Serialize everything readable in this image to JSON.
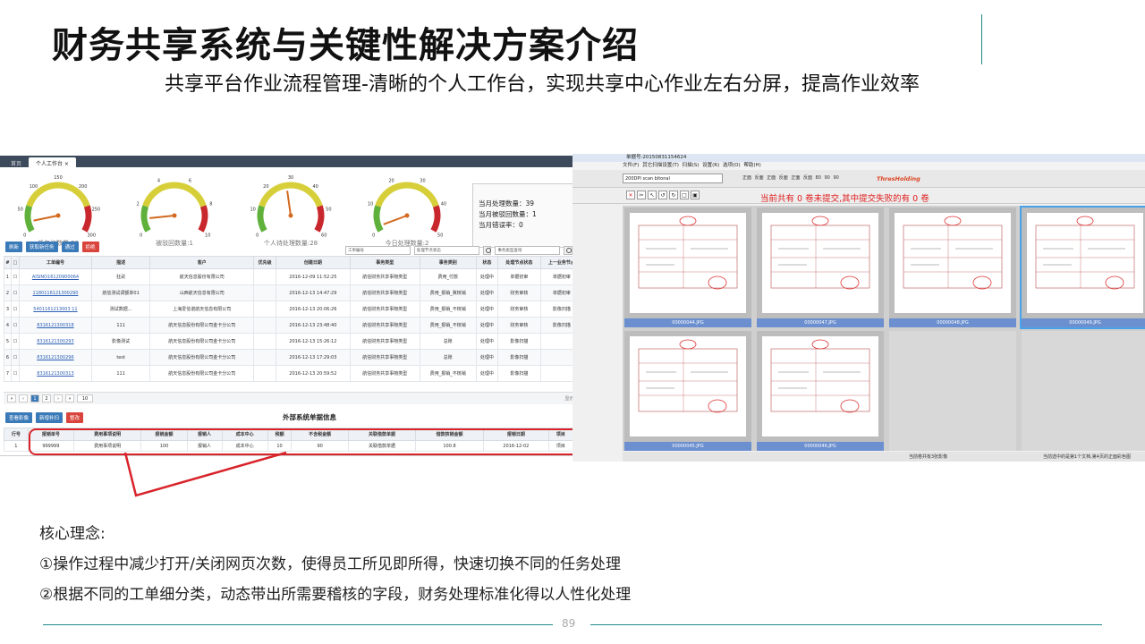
{
  "slide": {
    "title": "财务共享系统与关键性解决方案介绍",
    "subtitle": "共享平台作业流程管理-清晰的个人工作台，实现共享中心作业左右分屏，提高作业效率",
    "page_number": "89",
    "accent_color": "#1f8a8a",
    "highlight_color": "#d8232a"
  },
  "left_app": {
    "tabs": [
      "首页",
      "个人工作台 ×"
    ],
    "gauges": [
      {
        "label": "任务池数量:23",
        "ticks": [
          "0",
          "50",
          "100",
          "150",
          "200",
          "250",
          "300"
        ],
        "value": 23,
        "max": 300
      },
      {
        "label": "被驳回数量:1",
        "ticks": [
          "0",
          "2",
          "4",
          "6",
          "8",
          "10"
        ],
        "value": 1,
        "max": 10
      },
      {
        "label": "个人待处理数量:28",
        "ticks": [
          "0",
          "10",
          "20",
          "30",
          "40",
          "50",
          "60"
        ],
        "value": 28,
        "max": 60
      },
      {
        "label": "今日处理数量:2",
        "ticks": [
          "0",
          "10",
          "20",
          "30",
          "40",
          "50"
        ],
        "value": 2,
        "max": 50
      }
    ],
    "stats": [
      "当月处理数量：39",
      "当月被驳回数量：1",
      "当月错误率：0"
    ],
    "toolbar": [
      "刷新",
      "获取新任务",
      "通过",
      "拒绝"
    ],
    "search": {
      "field1": "工单编号",
      "field2": "处理节点状态",
      "field3": "事务类型查询",
      "query": "查询",
      "reset": "重置"
    },
    "columns": [
      "#",
      "□",
      "工单编号",
      "描述",
      "客户",
      "优先级",
      "创建日期",
      "事务类型",
      "事务类别",
      "状态",
      "处理节点状态",
      "上一业务节点",
      "上一操作人"
    ],
    "rows": [
      [
        "1",
        "☐",
        "AISINO16120900064",
        "狂武",
        "航天信息股份有限公司",
        "",
        "2016-12-09 11:52:25",
        "航信财务共享事物类型",
        "费用_付款",
        "处理中",
        "单据初审",
        "单据初审",
        "管理员"
      ],
      [
        "2",
        "☐",
        "1180116121300290",
        "航信测试调额单01",
        "山西航天信息有限公司",
        "",
        "2016-12-13 14:47:29",
        "航信财务共享事物类型",
        "费用_报销_冀核销",
        "处理中",
        "财务审核",
        "单据初审",
        "管理员"
      ],
      [
        "3",
        "☐",
        "5401161213003 11",
        "测试数据...",
        "上海爱信诺航天信息有限公司",
        "",
        "2016-12-13 20:06:26",
        "航信财务共享事物类型",
        "费用_报销_不核销",
        "处理中",
        "财务审核",
        "影像扫描",
        "管理员"
      ],
      [
        "4",
        "☐",
        "8316121300318",
        "111",
        "航天信息股份有限公司金卡分公司",
        "",
        "2016-12-13 23:48:40",
        "航信财务共享事物类型",
        "费用_报销_不核销",
        "处理中",
        "财务审核",
        "影像扫描",
        "管理员"
      ],
      [
        "5",
        "☐",
        "8316121300293",
        "影像测试",
        "航天信息股份有限公司金卡分公司",
        "",
        "2016-12-13 15:26:12",
        "航信财务共享事物类型",
        "总账",
        "处理中",
        "影像扫描",
        "",
        ""
      ],
      [
        "6",
        "☐",
        "8316121300296",
        "test",
        "航天信息股份有限公司金卡分公司",
        "",
        "2016-12-13 17:29:03",
        "航信财务共享事物类型",
        "总账",
        "处理中",
        "影像扫描",
        "",
        ""
      ],
      [
        "7",
        "☐",
        "8316121300313",
        "111",
        "航天信息股份有限公司金卡分公司",
        "",
        "2016-12-13 20:59:52",
        "航信财务共享事物类型",
        "费用_报销_不核销",
        "处理中",
        "影像扫描",
        "",
        ""
      ]
    ],
    "pager": {
      "pages": [
        "1",
        "2"
      ],
      "page_size": "10",
      "info": "显示条目 1 - 10 共 16"
    },
    "toolbar2": [
      "查看影像",
      "新增补扫",
      "整改"
    ],
    "ext_title": "外部系统单据信息",
    "ext_columns": [
      "行号",
      "报销单号",
      "费用事项说明",
      "报销金额",
      "报销人",
      "成本中心",
      "税额",
      "不含税金额",
      "关联借款单据",
      "借款核销金额",
      "报销日期",
      "项目",
      "发票代码"
    ],
    "ext_row": [
      "1",
      "999999",
      "费用事项说明",
      "100",
      "报销人",
      "成本中心",
      "10",
      "90",
      "关联借款单据",
      "100.8",
      "2016-12-02",
      "项目",
      "发票代码"
    ]
  },
  "right_app": {
    "title": "单据号:20150831154624",
    "menu": "文件(F)  其它扫描设置(T)  扫描(S)  设置(R)  选项(O)  帮助(H)",
    "combo": "200DPI scan bitonal",
    "tool_labels": "正面  反面   正面  反面   正面  反面   80  90  90",
    "threshold": "ThresHolding",
    "status": "当前共有 0 卷未提交,其中提交失败的有 0 卷",
    "thumbs": [
      "00000044.JPG",
      "00000047.JPG",
      "00000048.JPG",
      "00000049.JPG",
      "00000045.JPG",
      "00000046.JPG",
      "",
      ""
    ],
    "bar_left": "当前卷共有3张影像",
    "bar_right": "当前选中的是第1个文档,第4页的正面彩色图"
  },
  "core": {
    "heading": "核心理念:",
    "points": [
      "①操作过程中减少打开/关闭网页次数，使得员工所见即所得，快速切换不同的任务处理",
      "②根据不同的工单细分类，动态带出所需要稽核的字段，财务处理标准化得以人性化处理"
    ]
  }
}
